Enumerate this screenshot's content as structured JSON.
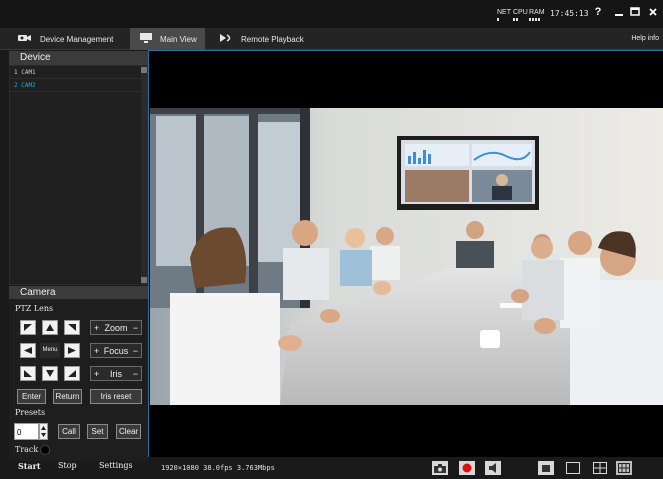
{
  "titlebar": {
    "stats": [
      "NET",
      "CPU",
      "RAM"
    ],
    "time": "17:45:13",
    "buttons": [
      "?",
      "–",
      "□",
      "×"
    ]
  },
  "tabs": [
    {
      "label": "Device Management",
      "icon": "camera-gear-icon",
      "active": false
    },
    {
      "label": "Main View",
      "icon": "monitor-icon",
      "active": true
    },
    {
      "label": "Remote Playback",
      "icon": "playback-icon",
      "active": false
    }
  ],
  "help_label": "Help info",
  "device": {
    "title": "Device",
    "items": [
      {
        "label": "1  CAM1",
        "selected": false
      },
      {
        "label": "2  CAM2",
        "selected": true
      }
    ]
  },
  "camera": {
    "title": "Camera",
    "ptz_label": "PTZ Lens",
    "menu_label": "Menu",
    "zoom_label": "Zoom",
    "focus_label": "Focus",
    "iris_label": "Iris",
    "plus": "+",
    "minus": "−",
    "enter_label": "Enter",
    "return_label": "Return",
    "iris_reset_label": "Iris reset",
    "presets_label": "Presets",
    "preset_value": "0",
    "call_label": "Call",
    "set_label": "Set",
    "clear_label": "Clear",
    "track_label": "Track",
    "start_label": "Start",
    "stop_label": "Stop",
    "settings_label": "Settings"
  },
  "status": {
    "resolution": "1920×1080 38.0fps 3.763Mbps"
  },
  "colors": {
    "accent": "#25a9d9",
    "record": "#e01010",
    "border": "#2b6fa6"
  }
}
